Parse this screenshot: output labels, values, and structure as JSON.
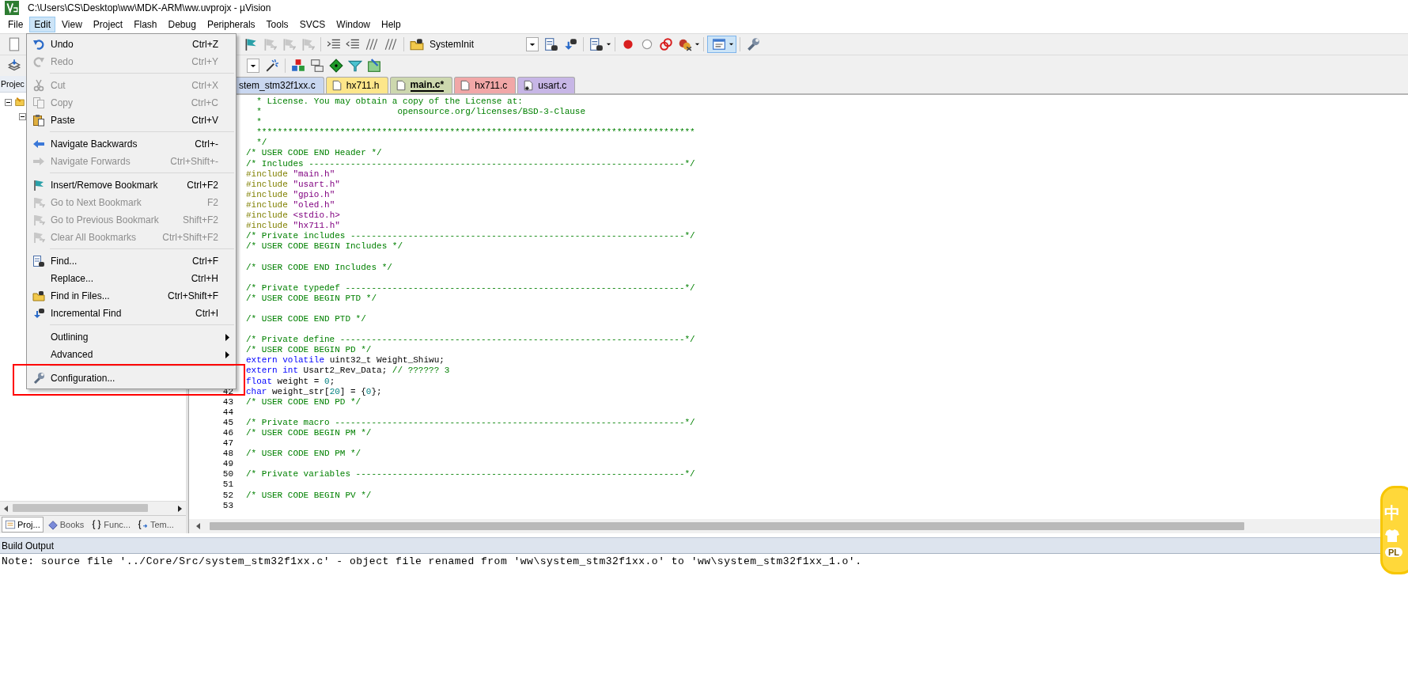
{
  "window": {
    "title": "C:\\Users\\CS\\Desktop\\ww\\MDK-ARM\\ww.uvprojx - µVision"
  },
  "menu_bar": [
    {
      "label": "File",
      "selected": false
    },
    {
      "label": "Edit",
      "selected": true
    },
    {
      "label": "View",
      "selected": false
    },
    {
      "label": "Project",
      "selected": false
    },
    {
      "label": "Flash",
      "selected": false
    },
    {
      "label": "Debug",
      "selected": false
    },
    {
      "label": "Peripherals",
      "selected": false
    },
    {
      "label": "Tools",
      "selected": false
    },
    {
      "label": "SVCS",
      "selected": false
    },
    {
      "label": "Window",
      "selected": false
    },
    {
      "label": "Help",
      "selected": false
    }
  ],
  "edit_menu": [
    {
      "kind": "item",
      "label": "Undo",
      "shortcut": "Ctrl+Z",
      "disabled": false
    },
    {
      "kind": "item",
      "label": "Redo",
      "shortcut": "Ctrl+Y",
      "disabled": true
    },
    {
      "kind": "separator"
    },
    {
      "kind": "item",
      "label": "Cut",
      "shortcut": "Ctrl+X",
      "disabled": true
    },
    {
      "kind": "item",
      "label": "Copy",
      "shortcut": "Ctrl+C",
      "disabled": true
    },
    {
      "kind": "item",
      "label": "Paste",
      "shortcut": "Ctrl+V",
      "disabled": false
    },
    {
      "kind": "separator"
    },
    {
      "kind": "item",
      "label": "Navigate Backwards",
      "shortcut": "Ctrl+-",
      "disabled": false
    },
    {
      "kind": "item",
      "label": "Navigate Forwards",
      "shortcut": "Ctrl+Shift+-",
      "disabled": true
    },
    {
      "kind": "separator"
    },
    {
      "kind": "item",
      "label": "Insert/Remove Bookmark",
      "shortcut": "Ctrl+F2",
      "disabled": false
    },
    {
      "kind": "item",
      "label": "Go to Next Bookmark",
      "shortcut": "F2",
      "disabled": true
    },
    {
      "kind": "item",
      "label": "Go to Previous Bookmark",
      "shortcut": "Shift+F2",
      "disabled": true
    },
    {
      "kind": "item",
      "label": "Clear All Bookmarks",
      "shortcut": "Ctrl+Shift+F2",
      "disabled": true
    },
    {
      "kind": "separator"
    },
    {
      "kind": "item",
      "label": "Find...",
      "shortcut": "Ctrl+F",
      "disabled": false
    },
    {
      "kind": "item",
      "label": "Replace...",
      "shortcut": "Ctrl+H",
      "disabled": false
    },
    {
      "kind": "item",
      "label": "Find in Files...",
      "shortcut": "Ctrl+Shift+F",
      "disabled": false
    },
    {
      "kind": "item",
      "label": "Incremental Find",
      "shortcut": "Ctrl+I",
      "disabled": false
    },
    {
      "kind": "separator"
    },
    {
      "kind": "submenu",
      "label": "Outlining",
      "disabled": false
    },
    {
      "kind": "submenu",
      "label": "Advanced",
      "disabled": false
    },
    {
      "kind": "separator"
    },
    {
      "kind": "item",
      "label": "Configuration...",
      "disabled": false
    }
  ],
  "toolbar": {
    "target_dropdown": "SystemInit"
  },
  "project_panel": {
    "title": "Projec",
    "tabs": [
      {
        "label": "Proj...",
        "selected": true
      },
      {
        "label": "Books",
        "selected": false
      },
      {
        "label": "Func...",
        "selected": false
      },
      {
        "label": "Tem...",
        "selected": false
      }
    ]
  },
  "editor": {
    "tabs": [
      {
        "label": "stem_stm32f1xx.c",
        "selected": false,
        "color": "#c9d7f0"
      },
      {
        "label": "hx711.h",
        "selected": false,
        "color": "#fde68a"
      },
      {
        "label": "main.c*",
        "selected": true,
        "color": "#cdd8ae"
      },
      {
        "label": "hx711.c",
        "selected": false,
        "color": "#f1a7a7"
      },
      {
        "label": "usart.c",
        "selected": false,
        "color": "#c7b6e6"
      }
    ],
    "lines": [
      {
        "kind": "code",
        "code": [
          {
            "kind": "comment",
            "text": "  * License. You may obtain a copy of the License at:"
          }
        ]
      },
      {
        "kind": "code",
        "code": [
          {
            "kind": "comment",
            "text": "  *                          opensource.org/licenses/BSD-3-Clause"
          }
        ]
      },
      {
        "kind": "code",
        "code": [
          {
            "kind": "comment",
            "text": "  *"
          }
        ]
      },
      {
        "kind": "code",
        "code": [
          {
            "kind": "comment",
            "text": "  ************************************************************************************"
          }
        ]
      },
      {
        "kind": "code",
        "code": [
          {
            "kind": "comment",
            "text": "  */"
          }
        ]
      },
      {
        "kind": "code",
        "code": [
          {
            "kind": "comment",
            "text": "/* USER CODE END Header */"
          }
        ]
      },
      {
        "kind": "code",
        "code": [
          {
            "kind": "comment",
            "text": "/* Includes ------------------------------------------------------------------------*/"
          }
        ]
      },
      {
        "kind": "code",
        "code": [
          {
            "kind": "preprocessor",
            "text": "#include "
          },
          {
            "kind": "string",
            "text": "\"main.h\""
          }
        ]
      },
      {
        "kind": "code",
        "code": [
          {
            "kind": "preprocessor",
            "text": "#include "
          },
          {
            "kind": "string",
            "text": "\"usart.h\""
          }
        ]
      },
      {
        "kind": "code",
        "code": [
          {
            "kind": "preprocessor",
            "text": "#include "
          },
          {
            "kind": "string",
            "text": "\"gpio.h\""
          }
        ]
      },
      {
        "kind": "code",
        "code": [
          {
            "kind": "preprocessor",
            "text": "#include "
          },
          {
            "kind": "string",
            "text": "\"oled.h\""
          }
        ]
      },
      {
        "kind": "code",
        "code": [
          {
            "kind": "preprocessor",
            "text": "#include "
          },
          {
            "kind": "string",
            "text": "<stdio.h>"
          }
        ]
      },
      {
        "kind": "code",
        "code": [
          {
            "kind": "preprocessor",
            "text": "#include "
          },
          {
            "kind": "string",
            "text": "\"hx711.h\""
          }
        ]
      },
      {
        "kind": "code",
        "code": [
          {
            "kind": "comment",
            "text": "/* Private includes ----------------------------------------------------------------*/"
          }
        ]
      },
      {
        "kind": "code",
        "code": [
          {
            "kind": "comment",
            "text": "/* USER CODE BEGIN Includes */"
          }
        ]
      },
      {
        "kind": "blank"
      },
      {
        "kind": "code",
        "code": [
          {
            "kind": "comment",
            "text": "/* USER CODE END Includes */"
          }
        ]
      },
      {
        "kind": "blank"
      },
      {
        "kind": "code",
        "code": [
          {
            "kind": "comment",
            "text": "/* Private typedef -----------------------------------------------------------------*/"
          }
        ]
      },
      {
        "kind": "code",
        "code": [
          {
            "kind": "comment",
            "text": "/* USER CODE BEGIN PTD */"
          }
        ]
      },
      {
        "kind": "blank"
      },
      {
        "kind": "code",
        "code": [
          {
            "kind": "comment",
            "text": "/* USER CODE END PTD */"
          }
        ]
      },
      {
        "kind": "blank"
      },
      {
        "kind": "code",
        "code": [
          {
            "kind": "comment",
            "text": "/* Private define ------------------------------------------------------------------*/"
          }
        ]
      },
      {
        "kind": "code",
        "code": [
          {
            "kind": "comment",
            "text": "/* USER CODE BEGIN PD */"
          }
        ]
      },
      {
        "kind": "code",
        "code": [
          {
            "kind": "keyword",
            "text": "extern"
          },
          {
            "kind": "keyword",
            "text": " volatile"
          },
          {
            "kind": "plain",
            "text": " uint32_t Weight_Shiwu;"
          }
        ]
      },
      {
        "kind": "code",
        "code": [
          {
            "kind": "keyword",
            "text": "extern"
          },
          {
            "kind": "keyword",
            "text": " int"
          },
          {
            "kind": "plain",
            "text": " Usart2_Rev_Data; "
          },
          {
            "kind": "comment",
            "text": "// ?????? 3"
          }
        ]
      },
      {
        "kind": "code",
        "code": [
          {
            "kind": "keyword",
            "text": "float"
          },
          {
            "kind": "plain",
            "text": " weight = "
          },
          {
            "kind": "number",
            "text": "0"
          },
          {
            "kind": "plain",
            "text": ";"
          }
        ]
      },
      {
        "kind": "code",
        "number": "42",
        "code": [
          {
            "kind": "keyword",
            "text": "char"
          },
          {
            "kind": "plain",
            "text": " weight_str["
          },
          {
            "kind": "number",
            "text": "20"
          },
          {
            "kind": "plain",
            "text": "] = {"
          },
          {
            "kind": "number",
            "text": "0"
          },
          {
            "kind": "plain",
            "text": "};"
          }
        ]
      },
      {
        "kind": "code",
        "number": "43",
        "code": [
          {
            "kind": "comment",
            "text": "/* USER CODE END PD */"
          }
        ]
      },
      {
        "kind": "blank",
        "number": "44"
      },
      {
        "kind": "code",
        "number": "45",
        "code": [
          {
            "kind": "comment",
            "text": "/* Private macro -------------------------------------------------------------------*/"
          }
        ]
      },
      {
        "kind": "code",
        "number": "46",
        "code": [
          {
            "kind": "comment",
            "text": "/* USER CODE BEGIN PM */"
          }
        ]
      },
      {
        "kind": "blank",
        "number": "47"
      },
      {
        "kind": "code",
        "number": "48",
        "code": [
          {
            "kind": "comment",
            "text": "/* USER CODE END PM */"
          }
        ]
      },
      {
        "kind": "blank",
        "number": "49"
      },
      {
        "kind": "code",
        "number": "50",
        "code": [
          {
            "kind": "comment",
            "text": "/* Private variables ---------------------------------------------------------------*/"
          }
        ]
      },
      {
        "kind": "blank",
        "number": "51"
      },
      {
        "kind": "code",
        "number": "52",
        "code": [
          {
            "kind": "comment",
            "text": "/* USER CODE BEGIN PV */"
          }
        ]
      },
      {
        "kind": "blank",
        "number": "53"
      }
    ]
  },
  "build_output": {
    "title": "Build Output",
    "lines": [
      "Note: source file '../Core/Src/system_stm32f1xx.c' - object file renamed from 'ww\\system_stm32f1xx.o' to 'ww\\system_stm32f1xx_1.o'."
    ]
  },
  "ime_indicator": {
    "label": "中",
    "badge": "PL"
  }
}
